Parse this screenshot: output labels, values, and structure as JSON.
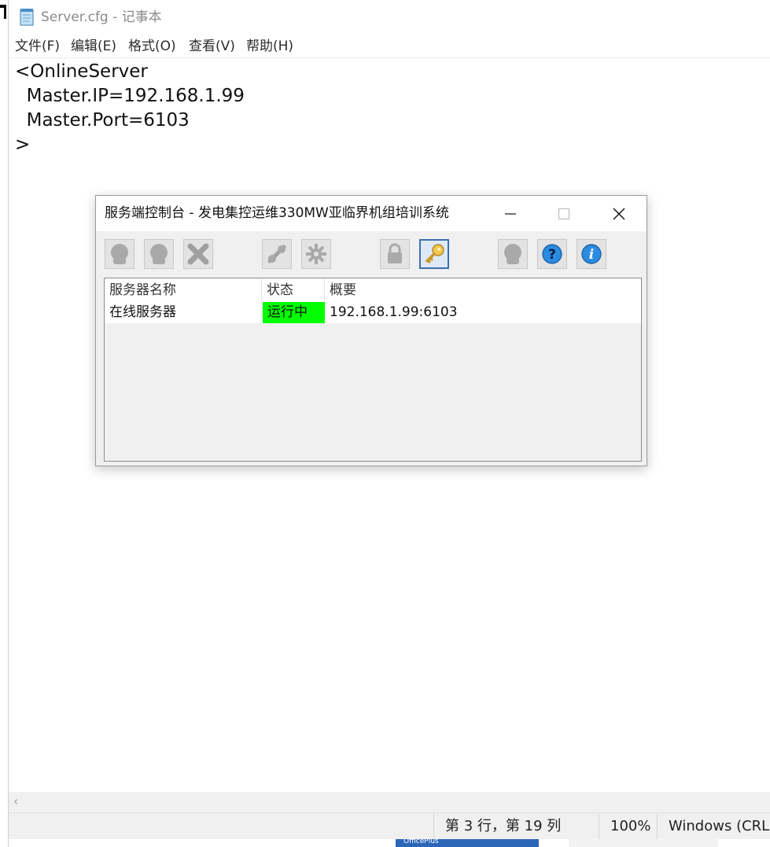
{
  "notepad": {
    "title": "Server.cfg - 记事本",
    "menu": [
      "文件(F)",
      "编辑(E)",
      "格式(O)",
      "查看(V)",
      "帮助(H)"
    ],
    "content_lines": [
      "<OnlineServer",
      "  Master.IP=192.168.1.99",
      "  Master.Port=6103",
      ">"
    ],
    "status": {
      "position": "第 3 行，第 19 列",
      "zoom": "100%",
      "line_ending": "Windows (CRLF"
    },
    "scroll_left_icon": "chevron-left-icon",
    "taskbar_text": "OfficePlus"
  },
  "dialog": {
    "title": "服务端控制台 - 发电集控运维330MW亚临界机组培训系统",
    "window_buttons": {
      "minimize": "—",
      "maximize": "☐",
      "close": "✕"
    },
    "toolbar": [
      {
        "name": "start-server-icon",
        "enabled": false
      },
      {
        "name": "stop-server-icon",
        "enabled": false
      },
      {
        "name": "delete-icon",
        "enabled": false
      },
      {
        "name": "connect-icon",
        "enabled": false
      },
      {
        "name": "settings-gear-icon",
        "enabled": false
      },
      {
        "name": "lock-icon",
        "enabled": false
      },
      {
        "name": "key-icon",
        "enabled": true
      },
      {
        "name": "user-icon",
        "enabled": false
      },
      {
        "name": "help-icon",
        "enabled": true
      },
      {
        "name": "info-icon",
        "enabled": true
      }
    ],
    "list": {
      "columns": [
        "服务器名称",
        "状态",
        "概要"
      ],
      "rows": [
        {
          "name": "在线服务器",
          "status": "运行中",
          "summary": "192.168.1.99:6103"
        }
      ]
    },
    "colors": {
      "running_status": "#00ff00",
      "accent": "#3a6fb0"
    }
  }
}
